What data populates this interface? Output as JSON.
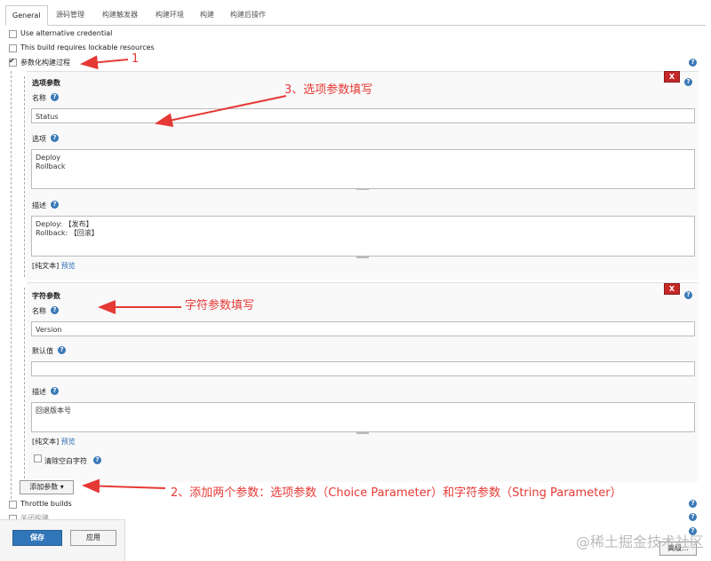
{
  "tabs": [
    "General",
    "源码管理",
    "构建触发器",
    "构建环境",
    "构建",
    "构建后操作"
  ],
  "options": {
    "alt_credential": "Use alternative credential",
    "lockable": "This build requires lockable resources",
    "parameterized": "参数化构建过程"
  },
  "choice_param": {
    "title": "选项参数",
    "name_label": "名称",
    "name_value": "Status",
    "options_label": "选项",
    "options_value": "Deploy\nRollback",
    "desc_label": "描述",
    "desc_value": "Deploy: 【发布】\nRollback: 【回滚】",
    "format_text": "[纯文本]",
    "preview": "预览",
    "delete": "X"
  },
  "string_param": {
    "title": "字符参数",
    "name_label": "名称",
    "name_value": "Version",
    "default_label": "默认值",
    "default_value": "",
    "desc_label": "描述",
    "desc_value": "回退版本号",
    "format_text": "[纯文本]",
    "preview": "预览",
    "trim_label": "清除空白字符",
    "delete": "X"
  },
  "add_param_button": "添加参数",
  "throttle_builds": "Throttle builds",
  "partial_next": "关闭构建",
  "save_button": "保存",
  "apply_button": "应用",
  "advanced_button": "高级...",
  "annotations": {
    "a1": "1",
    "a2": "2、添加两个参数：选项参数（Choice Parameter）和字符参数（String Parameter）",
    "a3": "3、选项参数填写",
    "a4": "字符参数填写"
  },
  "watermark": "@稀土掘金技术社区",
  "colors": {
    "annotation": "#e53935",
    "primary": "#3176b8",
    "delete": "#c62828",
    "help": "#3a78b7"
  }
}
